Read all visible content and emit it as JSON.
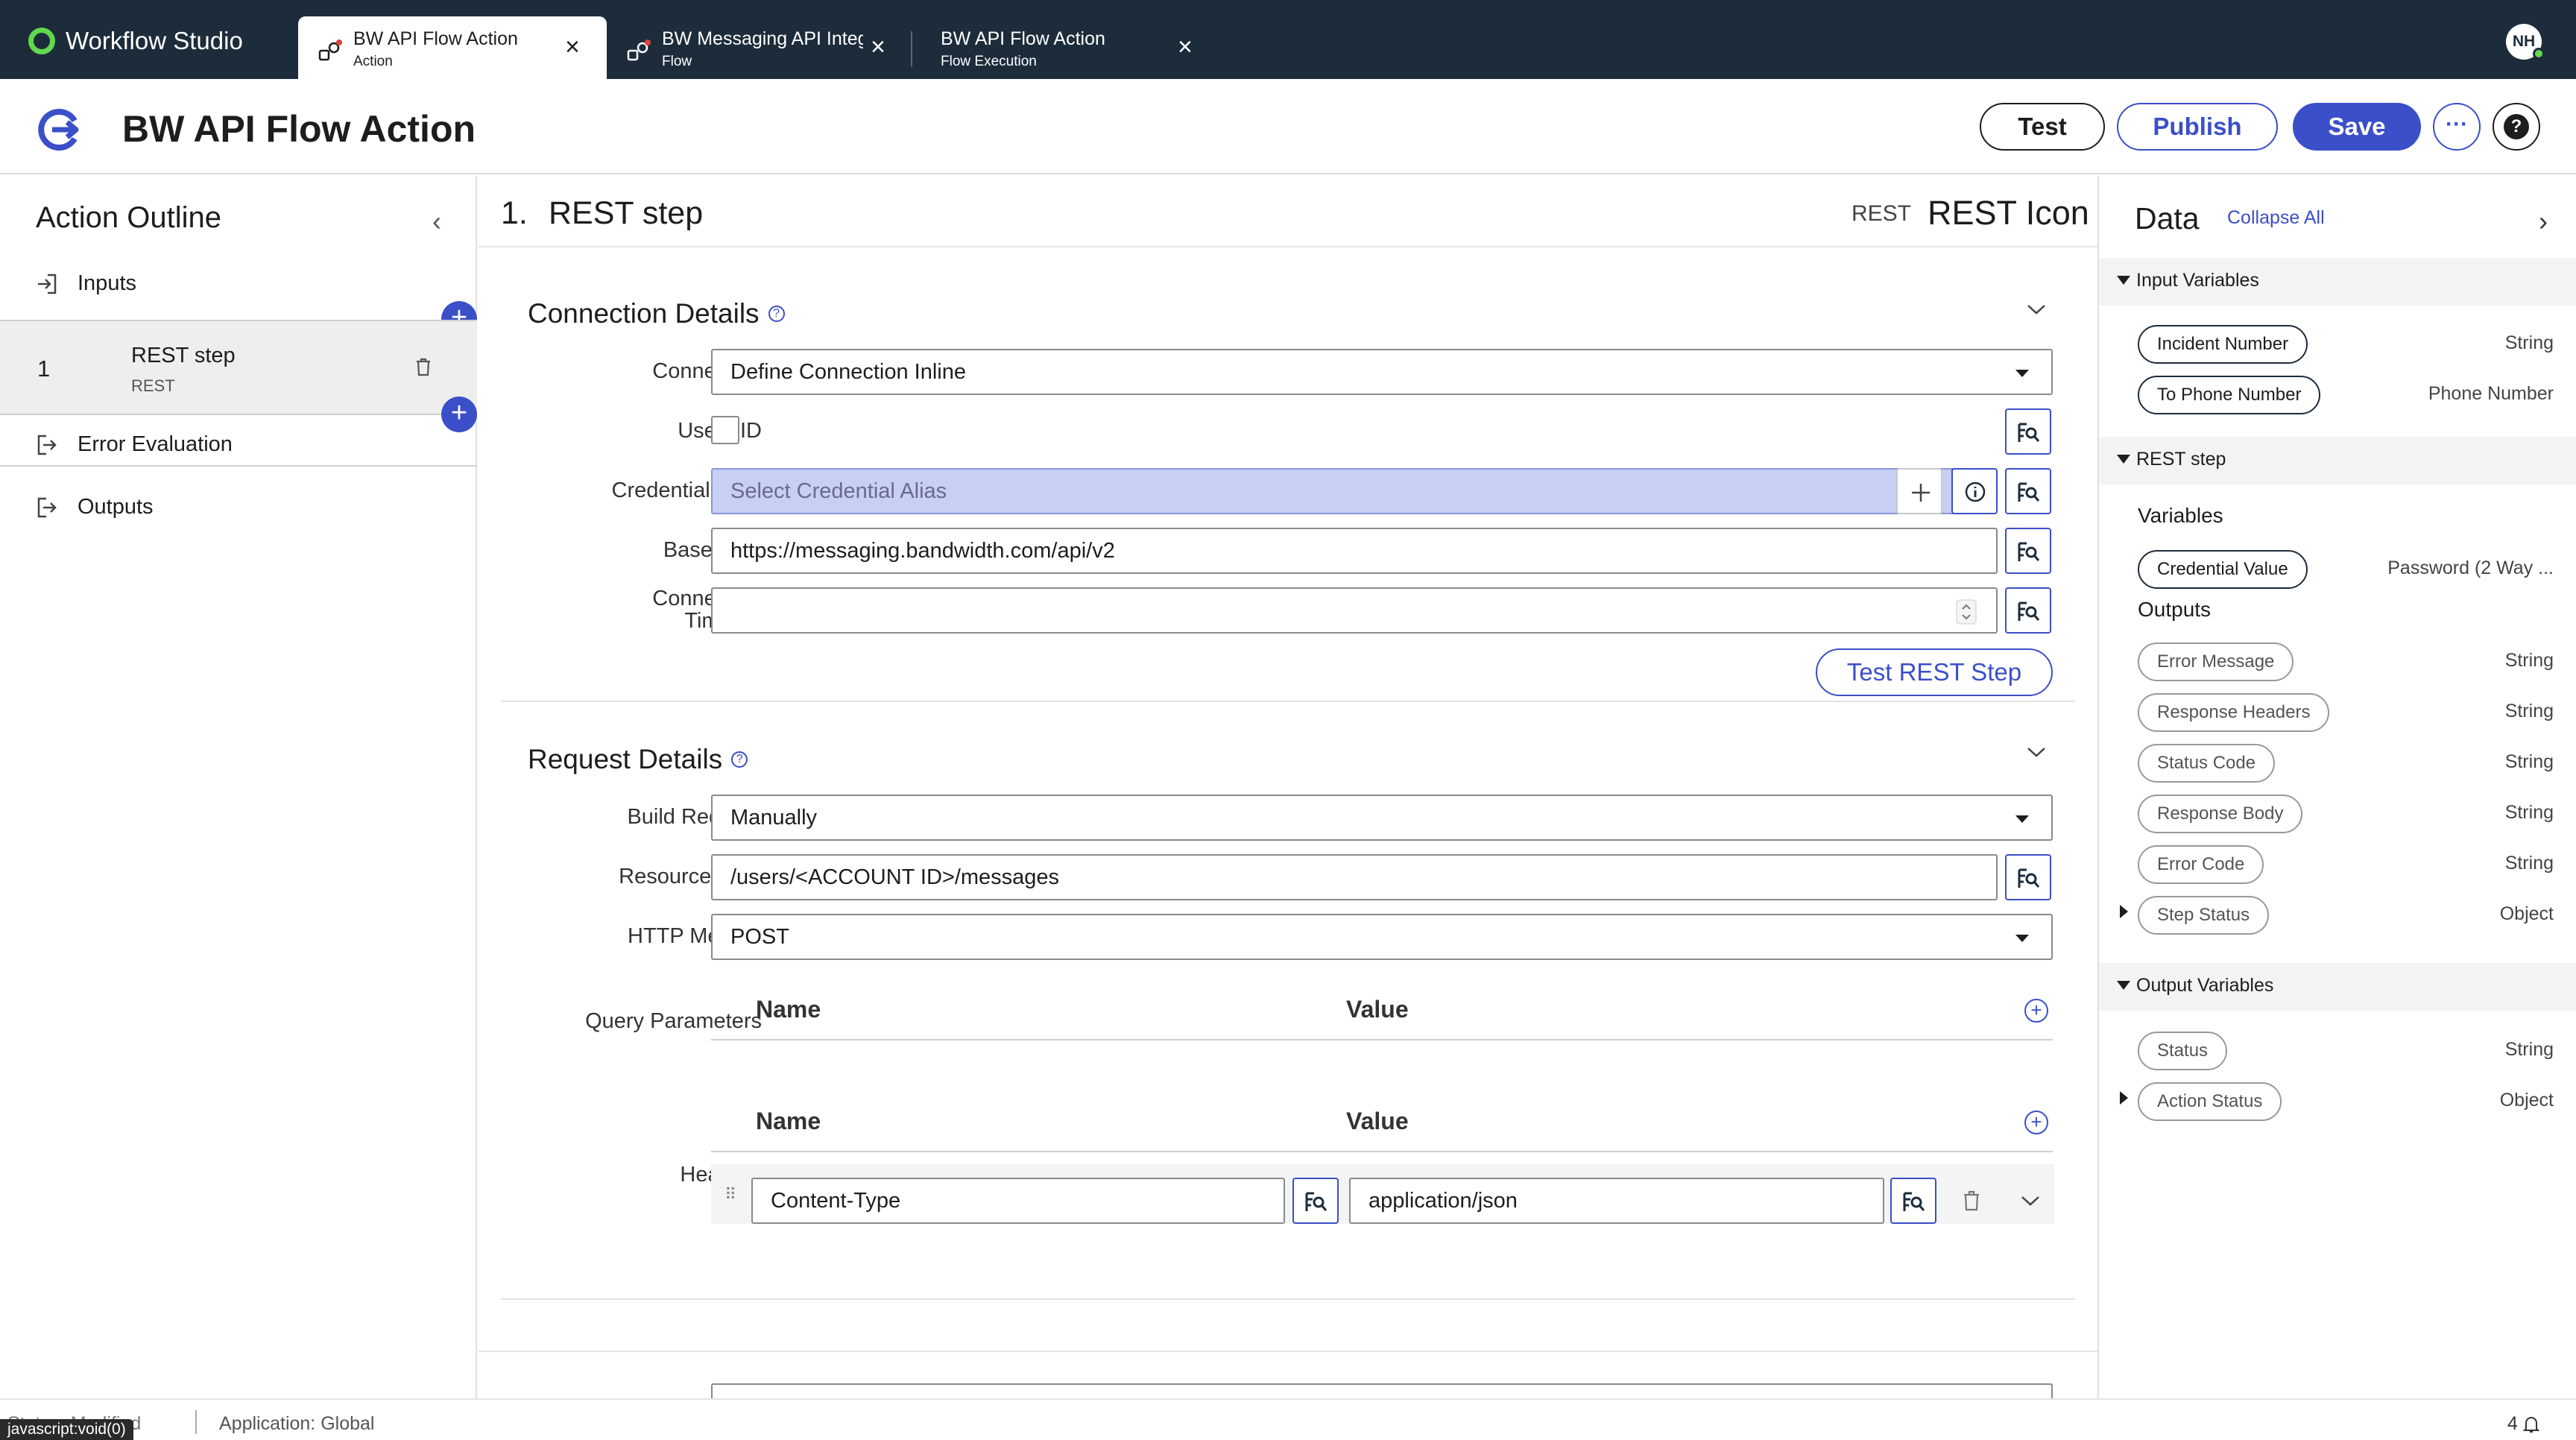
{
  "app": {
    "name": "Workflow Studio",
    "user_initials": "NH"
  },
  "tabs": [
    {
      "title": "BW API Flow Action",
      "subtitle": "Action"
    },
    {
      "title": "BW Messaging API Integ",
      "subtitle": "Flow"
    },
    {
      "title": "BW API Flow Action",
      "subtitle": "Flow Execution"
    }
  ],
  "header": {
    "title": "BW API Flow Action",
    "test_label": "Test",
    "publish_label": "Publish",
    "save_label": "Save",
    "more_label": "···",
    "help_label": "?"
  },
  "outline": {
    "title": "Action Outline",
    "inputs_label": "Inputs",
    "step": {
      "number": "1",
      "name": "REST step",
      "type": "REST"
    },
    "error_eval_label": "Error Evaluation",
    "outputs_label": "Outputs"
  },
  "step_header": {
    "number": "1.",
    "title": "REST step",
    "type_label": "REST",
    "icon_label": "REST Icon"
  },
  "connection": {
    "title": "Connection Details",
    "connection_label": "Connection",
    "connection_value": "Define Connection Inline",
    "use_mid_label": "Use MID",
    "credential_label": "Credential Alias",
    "credential_placeholder": "Select Credential Alias",
    "base_url_label": "Base URL",
    "base_url_value": "https://messaging.bandwidth.com/api/v2",
    "timeout_label_1": "Connection",
    "timeout_label_2": "Timeout",
    "timeout_value": "",
    "test_button": "Test REST Step"
  },
  "request": {
    "title": "Request Details",
    "build_label": "Build Request",
    "build_value": "Manually",
    "resource_label": "Resource Path",
    "resource_value": "/users/<ACCOUNT ID>/messages",
    "method_label": "HTTP Method",
    "method_value": "POST",
    "query_label": "Query Parameters",
    "headers_label": "Headers",
    "col_name": "Name",
    "col_value": "Value",
    "header_rows": [
      {
        "name": "Content-Type",
        "value": "application/json"
      }
    ]
  },
  "data_panel": {
    "title": "Data",
    "collapse_all": "Collapse All",
    "input_group": "Input Variables",
    "inputs": [
      {
        "name": "Incident Number",
        "type": "String"
      },
      {
        "name": "To Phone Number",
        "type": "Phone Number"
      }
    ],
    "step_group": "REST step",
    "variables_label": "Variables",
    "variables": [
      {
        "name": "Credential Value",
        "type": "Password (2 Way ..."
      }
    ],
    "outputs_label": "Outputs",
    "outputs": [
      {
        "name": "Error Message",
        "type": "String"
      },
      {
        "name": "Response Headers",
        "type": "String"
      },
      {
        "name": "Status Code",
        "type": "String"
      },
      {
        "name": "Response Body",
        "type": "String"
      },
      {
        "name": "Error Code",
        "type": "String"
      },
      {
        "name": "Step Status",
        "type": "Object"
      }
    ],
    "output_group": "Output Variables",
    "output_vars": [
      {
        "name": "Status",
        "type": "String"
      },
      {
        "name": "Action Status",
        "type": "Object"
      }
    ]
  },
  "statusbar": {
    "left": "Status: Modified",
    "application": "Application: Global",
    "right": "4",
    "link_tip": "javascript:void(0)"
  }
}
